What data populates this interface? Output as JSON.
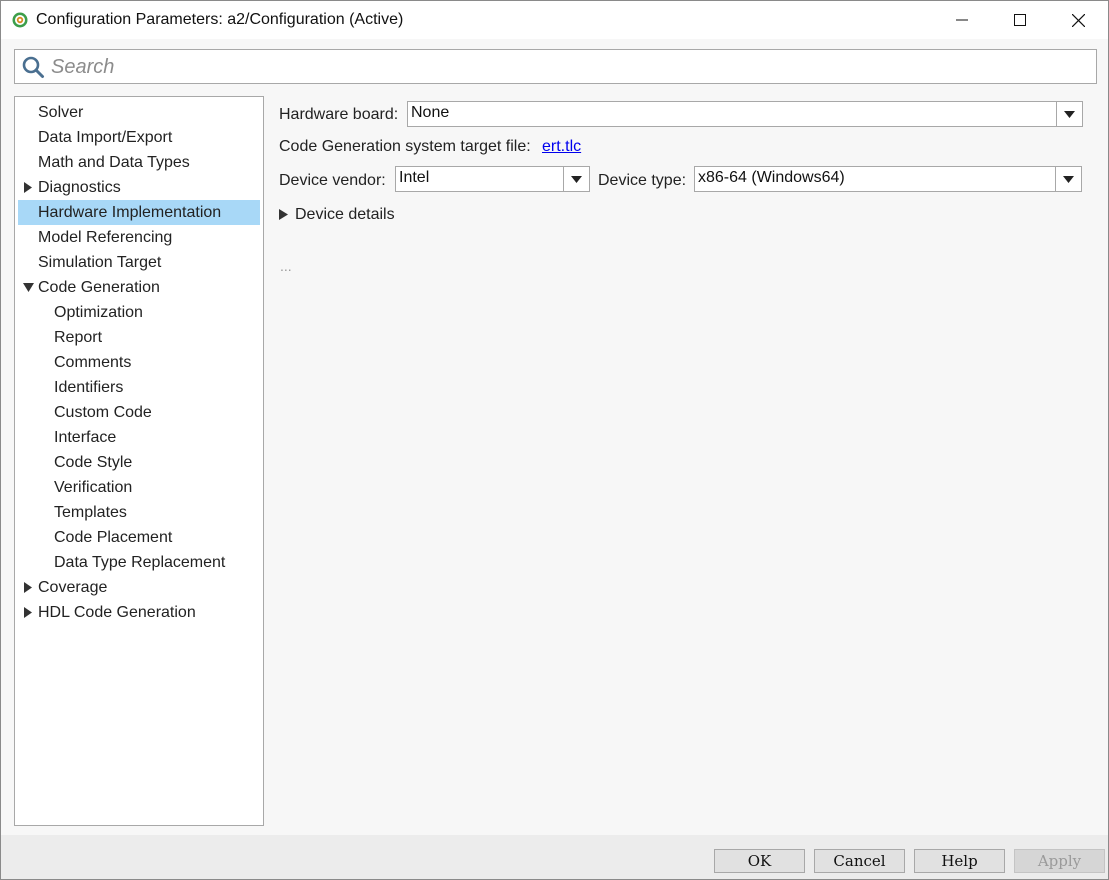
{
  "window": {
    "title": "Configuration Parameters: a2/Configuration (Active)",
    "icons": {
      "app": "gear-cog-icon",
      "minimize": "minimize-icon",
      "maximize": "maximize-icon",
      "close": "close-icon"
    }
  },
  "search": {
    "placeholder": "Search",
    "value": "",
    "icon": "search-icon"
  },
  "tree": {
    "items": [
      {
        "label": "Solver",
        "level": 0,
        "expander": "none"
      },
      {
        "label": "Data Import/Export",
        "level": 0,
        "expander": "none"
      },
      {
        "label": "Math and Data Types",
        "level": 0,
        "expander": "none"
      },
      {
        "label": "Diagnostics",
        "level": 0,
        "expander": "collapsed"
      },
      {
        "label": "Hardware Implementation",
        "level": 0,
        "expander": "none",
        "selected": true
      },
      {
        "label": "Model Referencing",
        "level": 0,
        "expander": "none"
      },
      {
        "label": "Simulation Target",
        "level": 0,
        "expander": "none"
      },
      {
        "label": "Code Generation",
        "level": 0,
        "expander": "expanded"
      },
      {
        "label": "Optimization",
        "level": 1,
        "expander": "none"
      },
      {
        "label": "Report",
        "level": 1,
        "expander": "none"
      },
      {
        "label": "Comments",
        "level": 1,
        "expander": "none"
      },
      {
        "label": "Identifiers",
        "level": 1,
        "expander": "none"
      },
      {
        "label": "Custom Code",
        "level": 1,
        "expander": "none"
      },
      {
        "label": "Interface",
        "level": 1,
        "expander": "none"
      },
      {
        "label": "Code Style",
        "level": 1,
        "expander": "none"
      },
      {
        "label": "Verification",
        "level": 1,
        "expander": "none"
      },
      {
        "label": "Templates",
        "level": 1,
        "expander": "none"
      },
      {
        "label": "Code Placement",
        "level": 1,
        "expander": "none"
      },
      {
        "label": "Data Type Replacement",
        "level": 1,
        "expander": "none"
      },
      {
        "label": "Coverage",
        "level": 0,
        "expander": "collapsed"
      },
      {
        "label": "HDL Code Generation",
        "level": 0,
        "expander": "collapsed"
      }
    ],
    "selected_color": "#a8d8f7"
  },
  "hardware": {
    "board_label": "Hardware board:",
    "board_value": "None",
    "target_file_label": "Code Generation system target file:",
    "target_file_link": "ert.tlc",
    "vendor_label": "Device vendor:",
    "vendor_value": "Intel",
    "type_label": "Device type:",
    "type_value": "x86-64 (Windows64)",
    "details_label": "Device details",
    "ellipsis": "..."
  },
  "buttons": {
    "ok": "OK",
    "cancel": "Cancel",
    "help": "Help",
    "apply": "Apply"
  },
  "colors": {
    "link": "#0000ee",
    "selection": "#a8d8f7"
  }
}
